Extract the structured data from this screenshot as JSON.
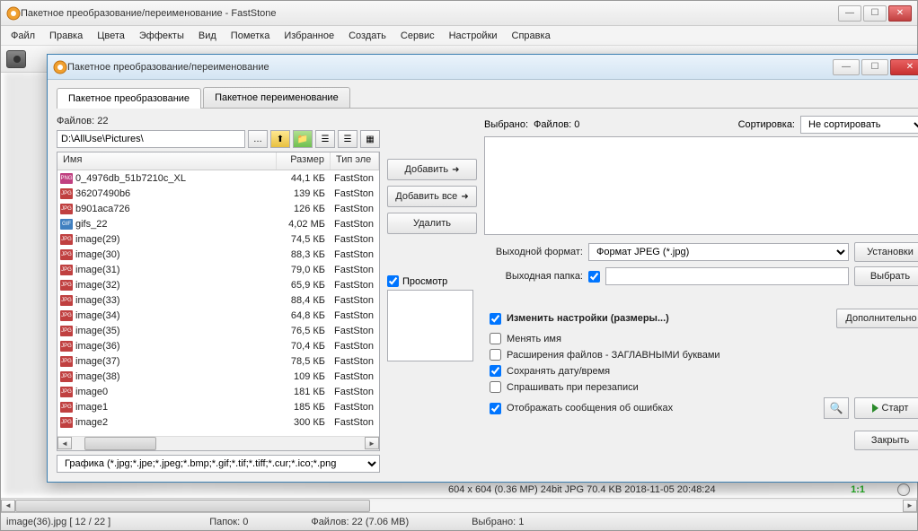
{
  "main_window": {
    "title": "Пакетное преобразование/переименование - FastStone",
    "menu": [
      "Файл",
      "Правка",
      "Цвета",
      "Эффекты",
      "Вид",
      "Пометка",
      "Избранное",
      "Создать",
      "Сервис",
      "Настройки",
      "Справка"
    ]
  },
  "dialog": {
    "title": "Пакетное преобразование/переименование",
    "tabs": {
      "convert": "Пакетное преобразование",
      "rename": "Пакетное переименование"
    },
    "file_count_label": "Файлов: 22",
    "path": "D:\\AllUse\\Pictures\\",
    "list_headers": {
      "name": "Имя",
      "size": "Размер",
      "type": "Тип эле"
    },
    "files": [
      {
        "icon": "png",
        "name": "0_4976db_51b7210c_XL",
        "size": "44,1 КБ",
        "type": "FastSton"
      },
      {
        "icon": "jpg",
        "name": "36207490b6",
        "size": "139 КБ",
        "type": "FastSton"
      },
      {
        "icon": "jpg",
        "name": "b901aca726",
        "size": "126 КБ",
        "type": "FastSton"
      },
      {
        "icon": "gif",
        "name": "gifs_22",
        "size": "4,02 МБ",
        "type": "FastSton"
      },
      {
        "icon": "jpg",
        "name": "image(29)",
        "size": "74,5 КБ",
        "type": "FastSton"
      },
      {
        "icon": "jpg",
        "name": "image(30)",
        "size": "88,3 КБ",
        "type": "FastSton"
      },
      {
        "icon": "jpg",
        "name": "image(31)",
        "size": "79,0 КБ",
        "type": "FastSton"
      },
      {
        "icon": "jpg",
        "name": "image(32)",
        "size": "65,9 КБ",
        "type": "FastSton"
      },
      {
        "icon": "jpg",
        "name": "image(33)",
        "size": "88,4 КБ",
        "type": "FastSton"
      },
      {
        "icon": "jpg",
        "name": "image(34)",
        "size": "64,8 КБ",
        "type": "FastSton"
      },
      {
        "icon": "jpg",
        "name": "image(35)",
        "size": "76,5 КБ",
        "type": "FastSton"
      },
      {
        "icon": "jpg",
        "name": "image(36)",
        "size": "70,4 КБ",
        "type": "FastSton"
      },
      {
        "icon": "jpg",
        "name": "image(37)",
        "size": "78,5 КБ",
        "type": "FastSton"
      },
      {
        "icon": "jpg",
        "name": "image(38)",
        "size": "109 КБ",
        "type": "FastSton"
      },
      {
        "icon": "jpg",
        "name": "image0",
        "size": "181 КБ",
        "type": "FastSton"
      },
      {
        "icon": "jpg",
        "name": "image1",
        "size": "185 КБ",
        "type": "FastSton"
      },
      {
        "icon": "jpg",
        "name": "image2",
        "size": "300 КБ",
        "type": "FastSton"
      }
    ],
    "filter": "Графика (*.jpg;*.jpe;*.jpeg;*.bmp;*.gif;*.tif;*.tiff;*.cur;*.ico;*.png",
    "buttons": {
      "add": "Добавить",
      "add_all": "Добавить все",
      "remove": "Удалить"
    },
    "preview_label": "Просмотр",
    "right": {
      "selected_label": "Выбрано:",
      "selected_count": "Файлов: 0",
      "sort_label": "Сортировка:",
      "sort_value": "Не сортировать",
      "format_label": "Выходной формат:",
      "format_value": "Формат JPEG (*.jpg)",
      "settings_btn": "Установки",
      "folder_label": "Выходная папка:",
      "folder_value": "",
      "browse_btn": "Выбрать"
    },
    "options": {
      "resize": "Изменить настройки (размеры...)",
      "advanced_btn": "Дополнительно",
      "rename": "Менять имя",
      "uppercase": "Расширения файлов - ЗАГЛАВНЫМИ буквами",
      "keep_date": "Сохранять дату/время",
      "ask_overwrite": "Спрашивать при перезаписи",
      "show_errors": "Отображать сообщения об ошибках"
    },
    "start_btn": "Старт",
    "close_btn": "Закрыть"
  },
  "info_bar": {
    "image_info": "604 x 604 (0.36 MP)  24bit  JPG  70.4 KB  2018-11-05 20:48:24",
    "ratio": "1:1"
  },
  "status": {
    "file": "image(36).jpg [ 12 / 22 ]",
    "folders": "Папок: 0",
    "files": "Файлов: 22 (7.06 MB)",
    "selected": "Выбрано: 1"
  }
}
